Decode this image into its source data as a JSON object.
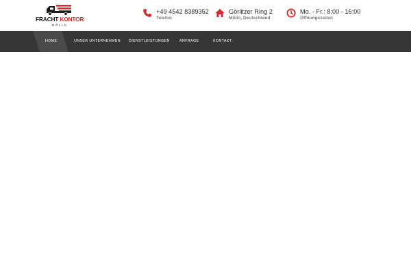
{
  "logo": {
    "title_part1": "FRACHT",
    "title_part2": "KONTOR",
    "subtitle": "MÖLLN",
    "icon": "truck-logo-icon",
    "colors": {
      "dark": "#1b1b1b",
      "accent": "#d42a2a"
    }
  },
  "contact": {
    "phone": {
      "icon": "phone-icon",
      "value": "+49 4542 8389352",
      "label": "Telefon"
    },
    "address": {
      "icon": "home-icon",
      "value": "Görlitzer Ring 2",
      "label": "Mölln, Deutschland"
    },
    "hours": {
      "icon": "clock-icon",
      "value": "Mo. - Fr.: 8:00 - 16:00",
      "label": "Öffnungszeiten"
    },
    "icon_color": "#d42a2a"
  },
  "nav": {
    "background": "#363636",
    "active_background": "#4a4a4a",
    "items": [
      {
        "label": "HOME",
        "active": true
      },
      {
        "label": "UNSER UNTERNEHMEN",
        "active": false
      },
      {
        "label": "DIENSTLEISTUNGEN",
        "active": false
      },
      {
        "label": "ANFRAGE",
        "active": false
      },
      {
        "label": "KONTAKT",
        "active": false
      }
    ]
  }
}
